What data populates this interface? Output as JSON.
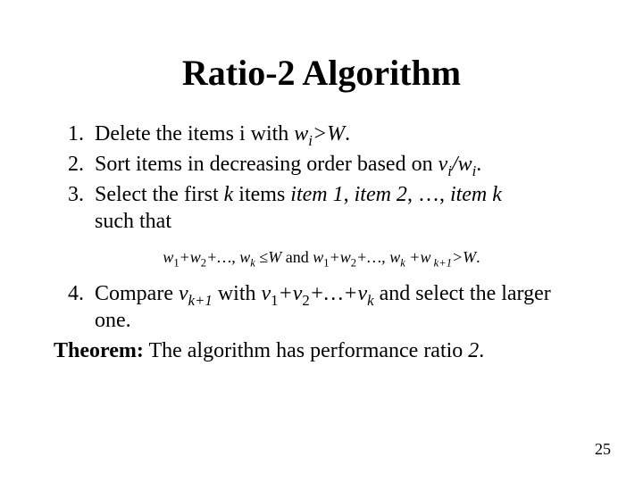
{
  "title": "Ratio-2 Algorithm",
  "step1": {
    "pre": "Delete the items i with ",
    "w": "w",
    "wi_sub": "i",
    "gt": ">",
    "W": "W",
    "dot": "."
  },
  "step2": {
    "pre": "Sort items in decreasing order based on ",
    "v": "v",
    "vi_sub": "i",
    "slash": "/",
    "w": "w",
    "wi_sub": "i",
    "dot": "."
  },
  "step3": {
    "pre": "Select the first ",
    "k": "k",
    "mid1": " items  ",
    "item1": "item 1",
    "comma1": ", ",
    "item2": "item 2",
    "comma2": ", …, ",
    "itemk": "item k",
    "such": "such that"
  },
  "constraint": {
    "w1": "w",
    "s1": "1",
    "plus1": "+",
    "w2": "w",
    "s2": "2",
    "plus2": "+…, ",
    "wk": "w",
    "sk": "k",
    "sp1": " ",
    "leq": "≤",
    "W": "W",
    "and": " and ",
    "w1b": "w",
    "s1b": "1",
    "plus1b": "+",
    "w2b": "w",
    "s2b": "2",
    "plus2b": "+…, ",
    "wkb": "w",
    "skb": "k",
    "sp2": " +",
    "wkp": "w",
    "skp": " k+1",
    "gt": ">",
    "Wb": "W",
    "dot": "."
  },
  "step4": {
    "pre": "Compare ",
    "vkp": "v",
    "skp": "k+1",
    "with": " with ",
    "v1": "v",
    "s1": "1",
    "plus1": "+",
    "v2": "v",
    "s2": "2",
    "plus2": "+…+",
    "vk": "v",
    "sk": "k",
    "post": " and select the larger one."
  },
  "theorem": {
    "label": "Theorem:",
    "text": " The algorithm has performance ratio ",
    "two": "2",
    "dot": "."
  },
  "page": "25"
}
